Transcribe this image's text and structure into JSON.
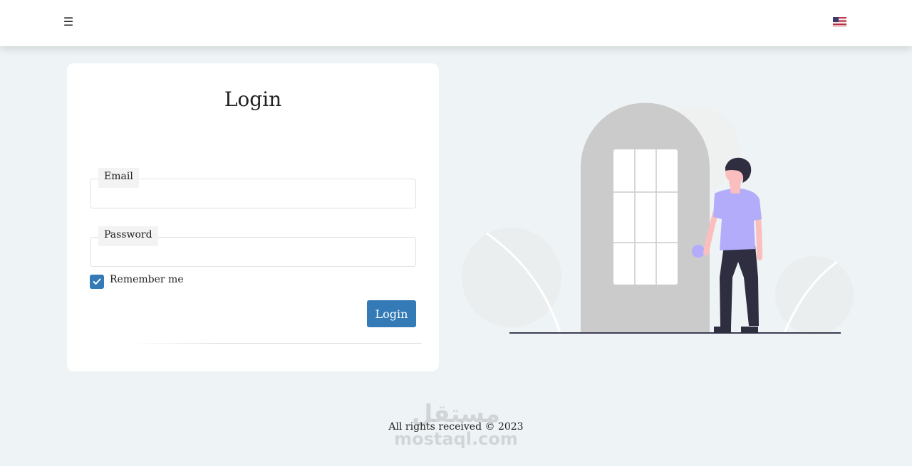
{
  "header": {
    "menu_icon": "☰",
    "language_flag_icon": "us-flag-icon"
  },
  "login": {
    "title": "Login",
    "email_label": "Email",
    "email_value": "",
    "password_label": "Password",
    "password_value": "",
    "remember_label": "Remember me",
    "remember_checked": true,
    "submit_label": "Login"
  },
  "footer": {
    "text": "All rights received © 2023"
  },
  "watermark": {
    "arabic": "مستقل",
    "latin": "mostaql.com"
  },
  "colors": {
    "accent": "#337ab7",
    "background": "#eef3f5",
    "person_shirt": "#b2acfa",
    "person_pants": "#2f2e41",
    "door": "#cbcbcb"
  }
}
